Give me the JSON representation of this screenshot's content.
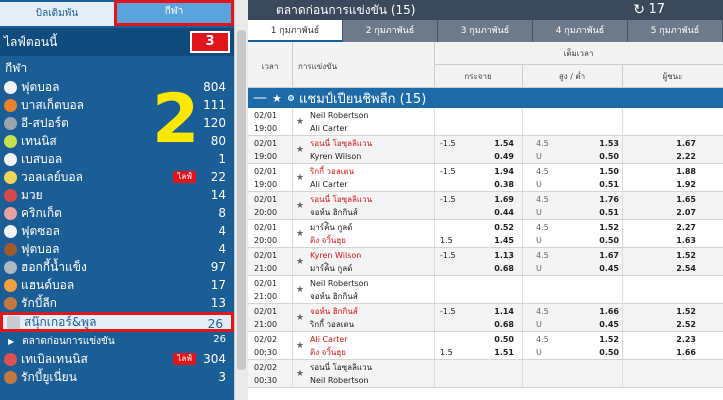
{
  "sidebar": {
    "tabs": [
      {
        "label": "บิลเดิมพัน"
      },
      {
        "label": "กีฬา"
      }
    ],
    "live_now": {
      "label": "ไลฟ์ตอนนี้",
      "count": "3"
    },
    "sports_title": "กีฬา",
    "annotation": "2",
    "sports": [
      {
        "label": "ฟุตบอล",
        "count": "804",
        "color": "#f2f2f2",
        "live": ""
      },
      {
        "label": "บาสเก็ตบอล",
        "count": "111",
        "color": "#e8812a",
        "live": ""
      },
      {
        "label": "อี-สปอร์ต",
        "count": "120",
        "color": "#9aa5b0",
        "live": ""
      },
      {
        "label": "เทนนิส",
        "count": "80",
        "color": "#c8e04a",
        "live": ""
      },
      {
        "label": "เบสบอล",
        "count": "1",
        "color": "#f2f2f2",
        "live": ""
      },
      {
        "label": "วอลเลย์บอล",
        "count": "22",
        "color": "#f0d45a",
        "live": "ไลฟ์"
      },
      {
        "label": "มวย",
        "count": "14",
        "color": "#d84a4a",
        "live": ""
      },
      {
        "label": "คริกเก็ต",
        "count": "8",
        "color": "#e6a0a0",
        "live": ""
      },
      {
        "label": "ฟุตซอล",
        "count": "4",
        "color": "#f2f2f2",
        "live": ""
      },
      {
        "label": "ฟุตบอล",
        "count": "4",
        "color": "#a05a2c",
        "live": ""
      },
      {
        "label": "ฮอกกี้น้ำแข็ง",
        "count": "97",
        "color": "#b0b8c0",
        "live": ""
      },
      {
        "label": "แฮนด์บอล",
        "count": "17",
        "color": "#f0a040",
        "live": ""
      },
      {
        "label": "รักบี้ลีก",
        "count": "13",
        "color": "#c07a40",
        "live": ""
      }
    ],
    "active_sport": {
      "label": "สนุ๊กเกอร์&พูล",
      "count": "26"
    },
    "sub_item": {
      "label": "ตลาดก่อนการแข่งขัน",
      "count": "26"
    },
    "after": [
      {
        "label": "เทเบิลเทนนิส",
        "count": "304",
        "color": "#e05050",
        "live": "ไลฟ์"
      },
      {
        "label": "รักบี้ยูเนี่ยน",
        "count": "3",
        "color": "#c07a40",
        "live": ""
      }
    ]
  },
  "main": {
    "title": "ตลาดก่อนการแข่งขัน (15)",
    "refresh_icon": "refresh-icon",
    "refresh_count": "17",
    "date_tabs": [
      "1 กุมภาพันธ์",
      "2 กุมภาพันธ์",
      "3 กุมภาพันธ์",
      "4 กุมภาพันธ์",
      "5 กุมภาพันธ์"
    ],
    "columns": {
      "time": "เวลา",
      "event": "การแข่งขัน",
      "fulltime": "เต็มเวลา",
      "handicap": "กระจาย",
      "over_under": "สูง / ต่ำ",
      "winner": "ผู้ชนะ"
    },
    "league": {
      "name": "แชมป์เปียนชิพลีก (15)"
    },
    "matches": [
      {
        "date": "02/01",
        "time": "19:00",
        "home": "Neil Robertson",
        "away": "Ali Carter",
        "home_fav": false,
        "away_fav": false,
        "hline": "",
        "hline2": "",
        "hodd1": "",
        "hodd2": "",
        "ou1": "",
        "ou2": "",
        "ouodd1": "",
        "ouodd2": "",
        "x1": "",
        "x2": ""
      },
      {
        "date": "02/01",
        "time": "19:00",
        "home": "รอนนี่ โอซุลลิแวน",
        "away": "Kyren Wilson",
        "home_fav": true,
        "away_fav": false,
        "hline": "-1.5",
        "hline2": "",
        "hodd1": "1.54",
        "hodd2": "0.49",
        "ou1": "4.5",
        "ou2": "U",
        "ouodd1": "1.53",
        "ouodd2": "0.50",
        "x1": "1.67",
        "x2": "2.22"
      },
      {
        "date": "02/01",
        "time": "19:00",
        "home": "ริกกี้ วอลเดน",
        "away": "Ali Carter",
        "home_fav": true,
        "away_fav": false,
        "hline": "-1.5",
        "hline2": "",
        "hodd1": "1.94",
        "hodd2": "0.38",
        "ou1": "4.5",
        "ou2": "U",
        "ouodd1": "1.50",
        "ouodd2": "0.51",
        "x1": "1.88",
        "x2": "1.92"
      },
      {
        "date": "02/01",
        "time": "20:00",
        "home": "รอนนี่ โอซุลลิแวน",
        "away": "จอห์น ฮิกกินส์",
        "home_fav": true,
        "away_fav": false,
        "hline": "-1.5",
        "hline2": "",
        "hodd1": "1.69",
        "hodd2": "0.44",
        "ou1": "4.5",
        "ou2": "U",
        "ouodd1": "1.76",
        "ouodd2": "0.51",
        "x1": "1.65",
        "x2": "2.07"
      },
      {
        "date": "02/01",
        "time": "20:00",
        "home": "มาร์ค์ิน กูลด์",
        "away": "ติง จวิ้นฮุย",
        "home_fav": false,
        "away_fav": true,
        "hline": "",
        "hline2": "1.5",
        "hodd1": "0.52",
        "hodd2": "1.45",
        "ou1": "4.5",
        "ou2": "U",
        "ouodd1": "1.52",
        "ouodd2": "0.50",
        "x1": "2.27",
        "x2": "1.63"
      },
      {
        "date": "02/01",
        "time": "21:00",
        "home": "Kyren Wilson",
        "away": "มาร์ค์ิน กูลด์",
        "home_fav": true,
        "away_fav": false,
        "hline": "-1.5",
        "hline2": "",
        "hodd1": "1.13",
        "hodd2": "0.68",
        "ou1": "4.5",
        "ou2": "U",
        "ouodd1": "1.67",
        "ouodd2": "0.45",
        "x1": "1.52",
        "x2": "2.54"
      },
      {
        "date": "02/01",
        "time": "21:00",
        "home": "Neil Robertson",
        "away": "จอห์น ฮิกกินส์",
        "home_fav": false,
        "away_fav": false,
        "hline": "",
        "hline2": "",
        "hodd1": "",
        "hodd2": "",
        "ou1": "",
        "ou2": "",
        "ouodd1": "",
        "ouodd2": "",
        "x1": "",
        "x2": ""
      },
      {
        "date": "02/01",
        "time": "21:00",
        "home": "จอห์น ฮิกกินส์",
        "away": "ริกกี้ วอลเดน",
        "home_fav": true,
        "away_fav": false,
        "hline": "-1.5",
        "hline2": "",
        "hodd1": "1.14",
        "hodd2": "0.68",
        "ou1": "4.5",
        "ou2": "U",
        "ouodd1": "1.66",
        "ouodd2": "0.45",
        "x1": "1.52",
        "x2": "2.52"
      },
      {
        "date": "02/02",
        "time": "00:30",
        "home": "Ali Carter",
        "away": "ติง จวิ้นฮุย",
        "home_fav": true,
        "away_fav": true,
        "hline": "",
        "hline2": "1.5",
        "hodd1": "0.50",
        "hodd2": "1.51",
        "ou1": "4.5",
        "ou2": "U",
        "ouodd1": "1.52",
        "ouodd2": "0.50",
        "x1": "2.23",
        "x2": "1.66"
      },
      {
        "date": "02/02",
        "time": "00:30",
        "home": "รอนนี่ โอซุลลิแวน",
        "away": "Neil Robertson",
        "home_fav": false,
        "away_fav": false,
        "hline": "",
        "hline2": "",
        "hodd1": "",
        "hodd2": "",
        "ou1": "",
        "ou2": "",
        "ouodd1": "",
        "ouodd2": "",
        "x1": "",
        "x2": ""
      }
    ]
  }
}
